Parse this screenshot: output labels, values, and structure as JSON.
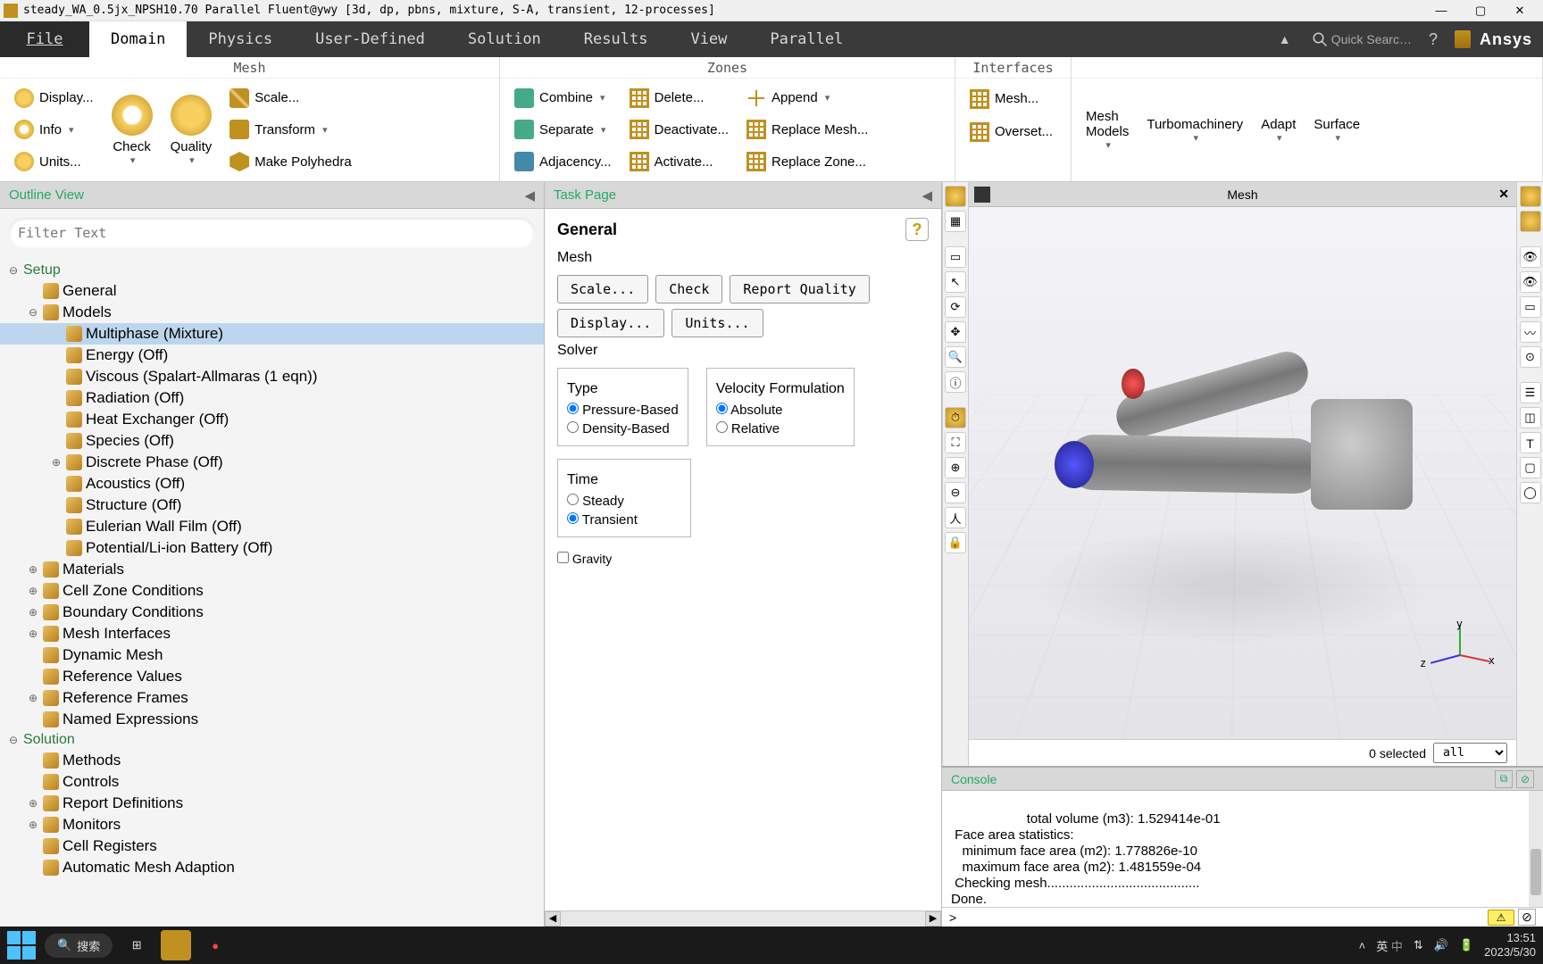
{
  "titlebar": {
    "title": "steady_WA_0.5jx_NPSH10.70 Parallel Fluent@ywy  [3d, dp, pbns, mixture, S-A, transient, 12-processes]"
  },
  "menu": {
    "file": "File",
    "tabs": [
      "Domain",
      "Physics",
      "User-Defined",
      "Solution",
      "Results",
      "View",
      "Parallel"
    ],
    "active": "Domain",
    "search_placeholder": "Quick Searc…",
    "logo": "Ansys"
  },
  "ribbon": {
    "mesh_hdr": "Mesh",
    "zones_hdr": "Zones",
    "interfaces_hdr": "Interfaces",
    "items": {
      "display": "Display...",
      "info": "Info",
      "units": "Units...",
      "check": "Check",
      "quality": "Quality",
      "scale": "Scale...",
      "transform": "Transform",
      "polyhedra": "Make Polyhedra",
      "combine": "Combine",
      "separate": "Separate",
      "adjacency": "Adjacency...",
      "delete": "Delete...",
      "deactivate": "Deactivate...",
      "activate": "Activate...",
      "append": "Append",
      "replace_mesh": "Replace Mesh...",
      "replace_zone": "Replace Zone...",
      "mesh_int": "Mesh...",
      "overset": "Overset...",
      "mesh_models": "Mesh\nModels",
      "turbo": "Turbomachinery",
      "adapt": "Adapt",
      "surface": "Surface"
    }
  },
  "outline": {
    "header": "Outline View",
    "filter_placeholder": "Filter Text",
    "tree": [
      {
        "d": 0,
        "exp": "-",
        "label": "Setup",
        "hdr": true
      },
      {
        "d": 1,
        "exp": "",
        "label": "General"
      },
      {
        "d": 1,
        "exp": "-",
        "label": "Models"
      },
      {
        "d": 2,
        "exp": "",
        "label": "Multiphase (Mixture)",
        "sel": true
      },
      {
        "d": 2,
        "exp": "",
        "label": "Energy (Off)"
      },
      {
        "d": 2,
        "exp": "",
        "label": "Viscous (Spalart-Allmaras (1 eqn))"
      },
      {
        "d": 2,
        "exp": "",
        "label": "Radiation (Off)"
      },
      {
        "d": 2,
        "exp": "",
        "label": "Heat Exchanger (Off)"
      },
      {
        "d": 2,
        "exp": "",
        "label": "Species (Off)"
      },
      {
        "d": 2,
        "exp": "+",
        "label": "Discrete Phase (Off)"
      },
      {
        "d": 2,
        "exp": "",
        "label": "Acoustics (Off)"
      },
      {
        "d": 2,
        "exp": "",
        "label": "Structure (Off)"
      },
      {
        "d": 2,
        "exp": "",
        "label": "Eulerian Wall Film (Off)"
      },
      {
        "d": 2,
        "exp": "",
        "label": "Potential/Li-ion Battery (Off)"
      },
      {
        "d": 1,
        "exp": "+",
        "label": "Materials"
      },
      {
        "d": 1,
        "exp": "+",
        "label": "Cell Zone Conditions"
      },
      {
        "d": 1,
        "exp": "+",
        "label": "Boundary Conditions"
      },
      {
        "d": 1,
        "exp": "+",
        "label": "Mesh Interfaces"
      },
      {
        "d": 1,
        "exp": "",
        "label": "Dynamic Mesh"
      },
      {
        "d": 1,
        "exp": "",
        "label": "Reference Values"
      },
      {
        "d": 1,
        "exp": "+",
        "label": "Reference Frames"
      },
      {
        "d": 1,
        "exp": "",
        "label": "Named Expressions"
      },
      {
        "d": 0,
        "exp": "-",
        "label": "Solution",
        "hdr": true
      },
      {
        "d": 1,
        "exp": "",
        "label": "Methods"
      },
      {
        "d": 1,
        "exp": "",
        "label": "Controls"
      },
      {
        "d": 1,
        "exp": "+",
        "label": "Report Definitions"
      },
      {
        "d": 1,
        "exp": "+",
        "label": "Monitors"
      },
      {
        "d": 1,
        "exp": "",
        "label": "Cell Registers"
      },
      {
        "d": 1,
        "exp": "",
        "label": "Automatic Mesh Adaption"
      }
    ]
  },
  "taskpage": {
    "header": "Task Page",
    "title": "General",
    "mesh_label": "Mesh",
    "btn_scale": "Scale...",
    "btn_check": "Check",
    "btn_report": "Report Quality",
    "btn_display": "Display...",
    "btn_units": "Units...",
    "solver_label": "Solver",
    "type_label": "Type",
    "type_pressure": "Pressure-Based",
    "type_density": "Density-Based",
    "vel_label": "Velocity Formulation",
    "vel_abs": "Absolute",
    "vel_rel": "Relative",
    "time_label": "Time",
    "time_steady": "Steady",
    "time_transient": "Transient",
    "gravity": "Gravity"
  },
  "viewport": {
    "title": "Mesh",
    "status_selected": "0 selected",
    "status_filter": "all",
    "axis": {
      "x": "x",
      "y": "y",
      "z": "z"
    }
  },
  "console": {
    "header": "Console",
    "lines": "   total volume (m3): 1.529414e-01\n Face area statistics:\n   minimum face area (m2): 1.778826e-10\n   maximum face area (m2): 1.481559e-04\n Checking mesh.........................................\nDone."
  },
  "taskbar": {
    "search": "搜索",
    "ime": "英",
    "ime2": "中",
    "time": "13:51",
    "date": "2023/5/30"
  }
}
